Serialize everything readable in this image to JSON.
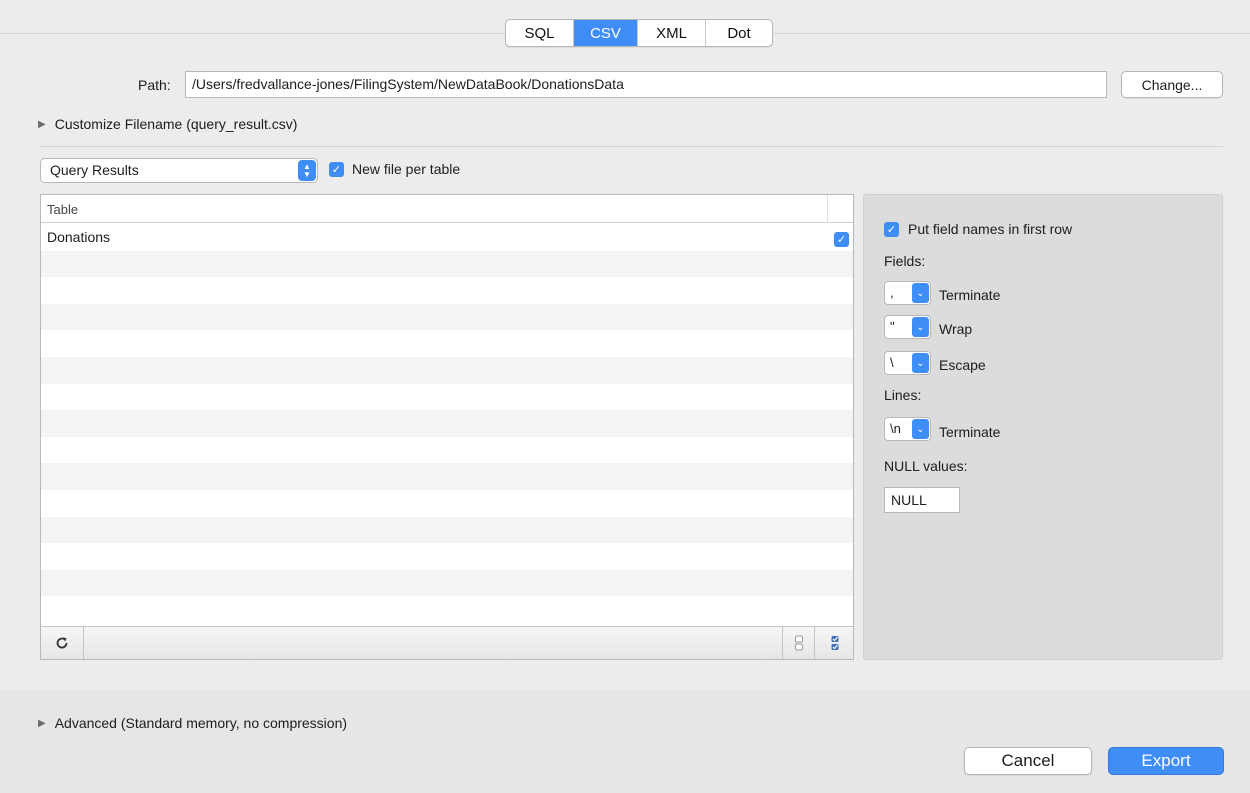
{
  "tabs": [
    {
      "label": "SQL",
      "active": false
    },
    {
      "label": "CSV",
      "active": true
    },
    {
      "label": "XML",
      "active": false
    },
    {
      "label": "Dot",
      "active": false
    }
  ],
  "path": {
    "label": "Path:",
    "value": "/Users/fredvallance-jones/FilingSystem/NewDataBook/DonationsData",
    "change_button": "Change..."
  },
  "customize_filename": "Customize Filename (query_result.csv)",
  "source_select": {
    "value": "Query Results"
  },
  "new_file_per_table": {
    "label": "New file per table",
    "checked": true
  },
  "table": {
    "header": "Table",
    "rows": [
      {
        "name": "Donations",
        "checked": true
      }
    ]
  },
  "options": {
    "field_names_first_row": {
      "label": "Put field names in first row",
      "checked": true
    },
    "fields_label": "Fields:",
    "fields": [
      {
        "value": ",",
        "label": "Terminate"
      },
      {
        "value": "\"",
        "label": "Wrap"
      },
      {
        "value": "\\",
        "label": "Escape"
      }
    ],
    "lines_label": "Lines:",
    "lines": [
      {
        "value": "\\n",
        "label": "Terminate"
      }
    ],
    "null_label": "NULL values:",
    "null_value": "NULL"
  },
  "advanced": "Advanced (Standard memory, no compression)",
  "buttons": {
    "cancel": "Cancel",
    "export": "Export"
  },
  "colors": {
    "accent": "#3f8ef7"
  }
}
